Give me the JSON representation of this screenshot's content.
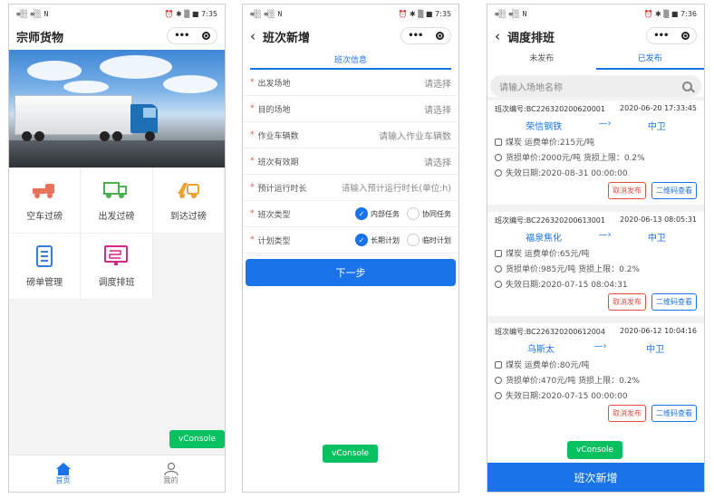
{
  "status": {
    "signal": "≡░░ ≡░░ N",
    "right1": "⏰ ✱ ▒ ■ 7:35",
    "right3": "⏰ ✱ ▒ ■ 7:36"
  },
  "screen1": {
    "title": "宗师货物",
    "grid": [
      {
        "label": "空车过磅",
        "icon": "empty-truck-icon",
        "color": "#e8735a"
      },
      {
        "label": "出发过磅",
        "icon": "depart-truck-icon",
        "color": "#4caf50"
      },
      {
        "label": "到达过磅",
        "icon": "arrive-truck-icon",
        "color": "#f0a030"
      },
      {
        "label": "磅单管理",
        "icon": "ticket-list-icon",
        "color": "#3b7bd8"
      },
      {
        "label": "调度排班",
        "icon": "schedule-icon",
        "color": "#d6278a"
      }
    ],
    "vconsole": "vConsole",
    "tabs": [
      {
        "label": "首页",
        "icon": "home-icon"
      },
      {
        "label": "我的",
        "icon": "person-icon"
      }
    ]
  },
  "screen2": {
    "title": "班次新增",
    "section": "班次信息",
    "fields": [
      {
        "label": "出发场地",
        "value": "请选择"
      },
      {
        "label": "目的场地",
        "value": "请选择"
      },
      {
        "label": "作业车辆数",
        "value": "请输入作业车辆数"
      },
      {
        "label": "班次有效期",
        "value": "请选择"
      },
      {
        "label": "预计运行时长",
        "value": "请输入预计运行时长(单位:h)"
      }
    ],
    "radio_fields": [
      {
        "label": "班次类型",
        "options": [
          "内部任务",
          "协同任务"
        ],
        "selected": 0
      },
      {
        "label": "计划类型",
        "options": [
          "长期计划",
          "临时计划"
        ],
        "selected": 0
      }
    ],
    "next": "下一步",
    "vconsole": "vConsole"
  },
  "screen3": {
    "title": "调度排班",
    "tabs": [
      "未发布",
      "已发布"
    ],
    "active_tab": 1,
    "search_placeholder": "请输入场地名称",
    "cards": [
      {
        "code": "班次编号:BC226320200620001",
        "time": "2020-06-20 17:33:45",
        "from": "荣信钢铁",
        "to": "中卫",
        "goods": "煤炭 运费单价:215元/吨",
        "loss": "货损单价:2000元/吨 货损上限：0.2%",
        "expire": "失效日期:2020-08-31 00:00:00",
        "cancel": "取消发布",
        "qr": "二维码查看"
      },
      {
        "code": "班次编号:BC226320200613001",
        "time": "2020-06-13 08:05:31",
        "from": "福泉焦化",
        "to": "中卫",
        "goods": "煤炭 运费单价:65元/吨",
        "loss": "货损单价:985元/吨 货损上限：0.2%",
        "expire": "失效日期:2020-07-15 08:04:31",
        "cancel": "取消发布",
        "qr": "二维码查看"
      },
      {
        "code": "班次编号:BC226320200612004",
        "time": "2020-06-12 10:04:16",
        "from": "乌斯太",
        "to": "中卫",
        "goods": "煤炭 运费单价:80元/吨",
        "loss": "货损单价:470元/吨 货损上限：0.2%",
        "expire": "失效日期:2020-07-15 00:00:00",
        "cancel": "取消发布",
        "qr": "二维码查看"
      }
    ],
    "arrow": "—›",
    "vconsole": "vConsole",
    "bottom": "班次新增"
  }
}
